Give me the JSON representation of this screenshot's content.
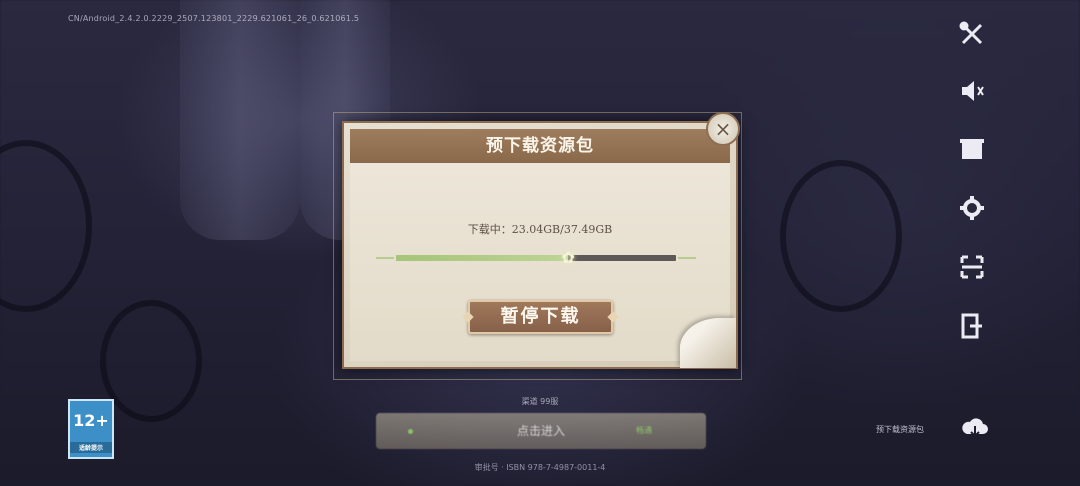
{
  "build_info": "CN/Android_2.4.2.0.2229_2507.123801_2229.621061_26_0.621061.5",
  "dialog": {
    "title": "预下载资源包",
    "status_label": "下载中：",
    "downloaded": "23.04GB",
    "total": "37.49GB",
    "status_text": "下载中：23.04GB/37.49GB",
    "progress_fraction": 0.615,
    "pause_button": "暂停下载",
    "close_symbol": "×"
  },
  "side_icons": [
    {
      "name": "tools-icon"
    },
    {
      "name": "sound-icon"
    },
    {
      "name": "notice-icon"
    },
    {
      "name": "settings-icon"
    },
    {
      "name": "scan-icon"
    },
    {
      "name": "exit-icon"
    }
  ],
  "age_rating": {
    "num": "12+",
    "sub": "适龄提示"
  },
  "version_line": "渠道   99服",
  "start_bar": {
    "label": "点击进入",
    "tag": "畅通"
  },
  "footer_line": "审批号   ·   ISBN 978-7-4987-0011-4",
  "pre_download_entry": "预下载资源包",
  "colors": {
    "panel": "#e3dbc9",
    "header": "#8a694b",
    "progress_fill": "#a6c47a",
    "track": "#5d5957"
  }
}
